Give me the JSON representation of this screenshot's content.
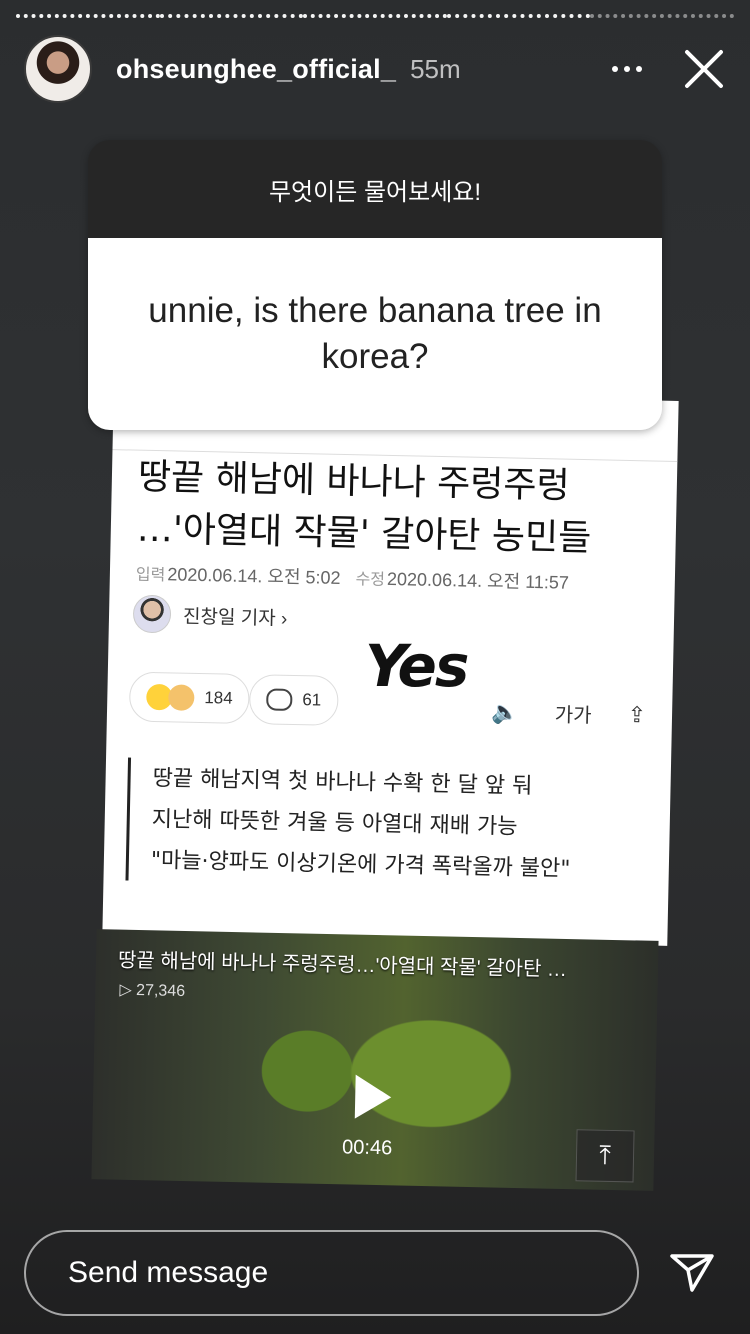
{
  "header": {
    "username": "ohseunghee_official_",
    "time": "55m"
  },
  "question": {
    "title": "무엇이든 물어보세요!",
    "text": "unnie, is there banana tree in korea?"
  },
  "article": {
    "headline": "땅끝 해남에 바나나 주렁주렁 …'아열대 작물' 갈아탄 농민들",
    "input_label": "입력",
    "input_date": "2020.06.14. 오전 5:02",
    "edit_label": "수정",
    "edit_date": "2020.06.14. 오전 11:57",
    "reporter": "진창일 기자 ›",
    "reactions_count": "184",
    "comments_count": "61",
    "font_size_label": "가가",
    "summary": [
      "땅끝 해남지역 첫 바나나 수확 한 달 앞 둬",
      "지난해 따뜻한 겨울 등 아열대 재배 가능",
      "\"마늘·양파도 이상기온에 가격 폭락올까 불안\""
    ]
  },
  "sticker": {
    "text": "Yes"
  },
  "video": {
    "title": "땅끝 해남에 바나나 주렁주렁…'아열대 작물' 갈아탄 …",
    "views": "▷ 27,346",
    "duration": "00:46"
  },
  "footer": {
    "placeholder": "Send message"
  }
}
